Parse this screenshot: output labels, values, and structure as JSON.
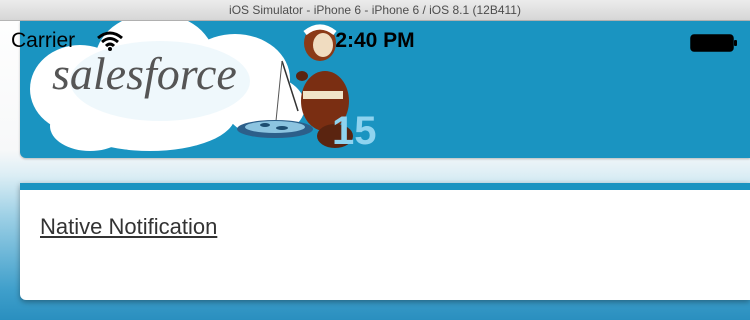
{
  "window": {
    "title": "iOS Simulator - iPhone 6 - iPhone 6 / iOS 8.1 (12B411)"
  },
  "status_bar": {
    "carrier": "Carrier",
    "time": "2:40 PM",
    "wifi_icon": "wifi-icon",
    "battery_icon": "battery-icon"
  },
  "header": {
    "logo_text": "salesforce",
    "release_number": "15"
  },
  "content": {
    "link_label": "Native Notification"
  },
  "colors": {
    "brand_blue": "#1a94c1",
    "cloud": "#ffffff",
    "logo_text": "#555555"
  }
}
